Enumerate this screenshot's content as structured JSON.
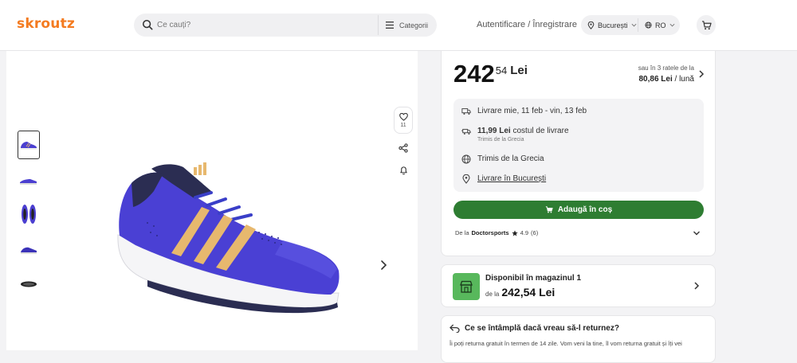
{
  "header": {
    "logo": "skroutz",
    "search_placeholder": "Ce cauți?",
    "categories_label": "Categorii",
    "login_label": "Autentificare / Înregistrare",
    "city": "București",
    "language": "RO"
  },
  "gallery": {
    "favorites_count": "11"
  },
  "price": {
    "integer": "242",
    "decimals": "54",
    "currency": "Lei"
  },
  "installments": {
    "line1": "sau în 3 ratele de la",
    "amount": "80,86 Lei",
    "period": "/ lună"
  },
  "delivery": {
    "date_text": "Livrare mie, 11 feb - vin, 13 feb",
    "cost": "11,99 Lei",
    "cost_suffix": "costul de livrare",
    "cost_sub": "Trimis de la Grecia",
    "shipped_from": "Trimis de la Grecia",
    "delivery_city_link": "Livrare în București"
  },
  "cart": {
    "add_label": "Adaugă în coș"
  },
  "seller": {
    "prefix": "De la",
    "name": "Doctorsports",
    "rating": "4.9",
    "reviews": "(6)"
  },
  "store": {
    "title": "Disponibil în magazinul 1",
    "price_prefix": "de la",
    "price": "242,54 Lei"
  },
  "returns": {
    "title": "Ce se întâmplă dacă vreau să-l returnez?",
    "text": "Îi poți returna gratuit în termen de 14 zile. Vom veni la tine, îl vom returna gratuit și îți vei"
  },
  "colors": {
    "brand": "#f47b20",
    "cta": "#2e7d32",
    "store_icon_bg": "#58b85c"
  }
}
